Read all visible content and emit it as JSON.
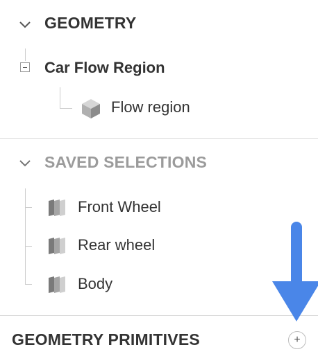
{
  "geometry": {
    "title": "GEOMETRY",
    "group": {
      "label": "Car Flow Region",
      "children": [
        {
          "label": "Flow region",
          "icon": "cube-icon"
        }
      ]
    }
  },
  "saved_selections": {
    "title": "SAVED SELECTIONS",
    "items": [
      {
        "label": "Front Wheel",
        "icon": "selection-icon"
      },
      {
        "label": "Rear wheel",
        "icon": "selection-icon"
      },
      {
        "label": "Body",
        "icon": "selection-icon"
      }
    ]
  },
  "geometry_primitives": {
    "title": "GEOMETRY PRIMITIVES",
    "add_icon": "plus-icon",
    "add_symbol": "+"
  },
  "annotation": {
    "arrow_color": "#4a86e8"
  },
  "colors": {
    "text": "#333333",
    "muted_header": "#9b9b9b",
    "divider": "#d9d9d9",
    "tree_line": "#cccccc"
  }
}
